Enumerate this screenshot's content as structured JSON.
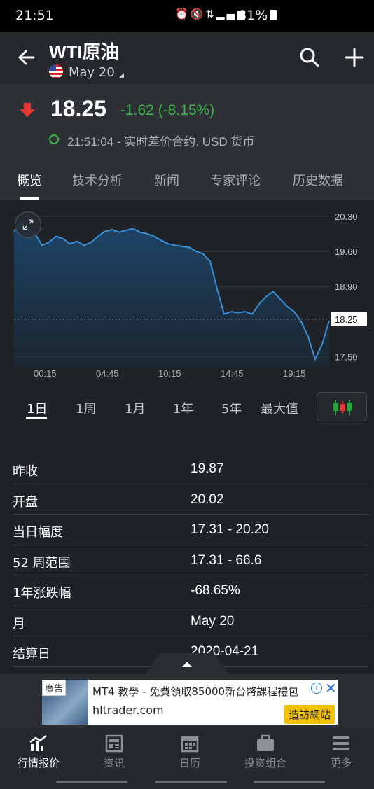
{
  "status": {
    "time": "21:51",
    "battery": "81%"
  },
  "header": {
    "title": "WTI原油",
    "contract": "May 20"
  },
  "quote": {
    "price": "18.25",
    "change": "-1.62 (-8.15%)",
    "timestamp": "21:51:04 - 实时差价合约. USD 货币",
    "colors": {
      "down": "#e53935",
      "change": "#3cb54b"
    }
  },
  "tabs": [
    "概览",
    "技术分析",
    "新闻",
    "专家评论",
    "历史数据"
  ],
  "chart_data": {
    "type": "area",
    "x_ticks": [
      "00:15",
      "04:45",
      "10:15",
      "14:45",
      "19:15"
    ],
    "y_ticks": [
      "20.30",
      "19.60",
      "18.90",
      "17.50"
    ],
    "last_value_label": "18.25",
    "ylim": [
      17.3,
      20.45
    ],
    "x": [
      0,
      1,
      2,
      3,
      4,
      5,
      6,
      7,
      8,
      9,
      10,
      11,
      12,
      13,
      14,
      15,
      16,
      17,
      18,
      19,
      20,
      21,
      22,
      23,
      24,
      25,
      26,
      27,
      28,
      29,
      30,
      31,
      32,
      33,
      34,
      35,
      36,
      37,
      38,
      39,
      40,
      41,
      42,
      43,
      44,
      45
    ],
    "values": [
      20.0,
      20.2,
      20.05,
      19.95,
      19.72,
      19.78,
      19.9,
      19.85,
      19.75,
      19.8,
      19.72,
      19.78,
      19.9,
      20.0,
      20.03,
      19.98,
      20.02,
      20.05,
      19.98,
      19.95,
      19.9,
      19.82,
      19.75,
      19.72,
      19.7,
      19.68,
      19.6,
      19.55,
      19.4,
      18.85,
      18.35,
      18.4,
      18.38,
      18.4,
      18.35,
      18.55,
      18.7,
      18.8,
      18.65,
      18.5,
      18.4,
      18.2,
      17.9,
      17.45,
      17.75,
      18.22
    ],
    "color": "#3b8fd6"
  },
  "ranges": [
    "1日",
    "1周",
    "1月",
    "1年",
    "5年",
    "最大值"
  ],
  "stats": [
    {
      "label": "昨收",
      "value": "19.87"
    },
    {
      "label": "开盘",
      "value": "20.02"
    },
    {
      "label": "当日幅度",
      "value": "17.31 - 20.20"
    },
    {
      "label": "52 周范围",
      "value": "17.31 - 66.6"
    },
    {
      "label": "1年涨跌幅",
      "value": "-68.65%"
    },
    {
      "label": "月",
      "value": "May 20"
    },
    {
      "label": "结算日",
      "value": "2020-04-21"
    }
  ],
  "ad": {
    "tag": "廣告",
    "headline": "MT4 教學 - 免費領取85000新台幣課程禮包",
    "domain": "hltrader.com",
    "cta": "造訪網站"
  },
  "nav": [
    "行情报价",
    "资讯",
    "日历",
    "投资组合",
    "更多"
  ]
}
